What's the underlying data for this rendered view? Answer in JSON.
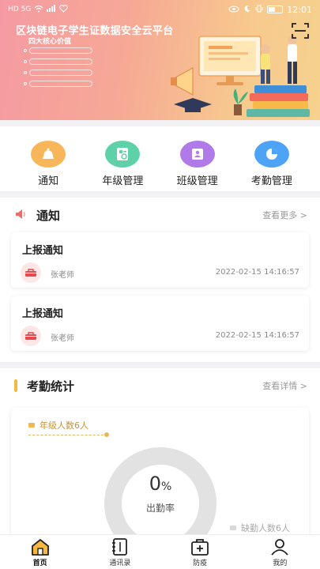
{
  "status_bar": {
    "network": "HD 5G",
    "time": "12:01"
  },
  "banner": {
    "title": "区块链电子学生证数据安全云平台",
    "subtitle": "四大核心价值",
    "scan_icon": "scan-icon"
  },
  "menu": [
    {
      "label": "通知",
      "icon": "bell-icon",
      "color": "#f7b659"
    },
    {
      "label": "年级管理",
      "icon": "grade-icon",
      "color": "#5fd1a8"
    },
    {
      "label": "班级管理",
      "icon": "class-icon",
      "color": "#b07be8"
    },
    {
      "label": "考勤管理",
      "icon": "pie-chart-icon",
      "color": "#4da3f5"
    }
  ],
  "notice_section": {
    "title": "通知",
    "more": "查看更多 >",
    "items": [
      {
        "title": "上报通知",
        "author": "张老师",
        "time": "2022-02-15 14:16:57"
      },
      {
        "title": "上报通知",
        "author": "张老师",
        "time": "2022-02-15 14:16:57"
      }
    ]
  },
  "attendance": {
    "title": "考勤统计",
    "more": "查看详情 >",
    "grade_count": "年级人数6人",
    "percent": "0",
    "percent_unit": "%",
    "percent_label": "出勤率",
    "absent_count": "缺勤人数6人",
    "attendance_rate": 0
  },
  "bottom_nav": [
    {
      "label": "首页",
      "icon": "home-icon",
      "active": true
    },
    {
      "label": "通讯录",
      "icon": "contacts-icon",
      "active": false
    },
    {
      "label": "防疫",
      "icon": "medical-kit-icon",
      "active": false
    },
    {
      "label": "我的",
      "icon": "user-icon",
      "active": false
    }
  ]
}
